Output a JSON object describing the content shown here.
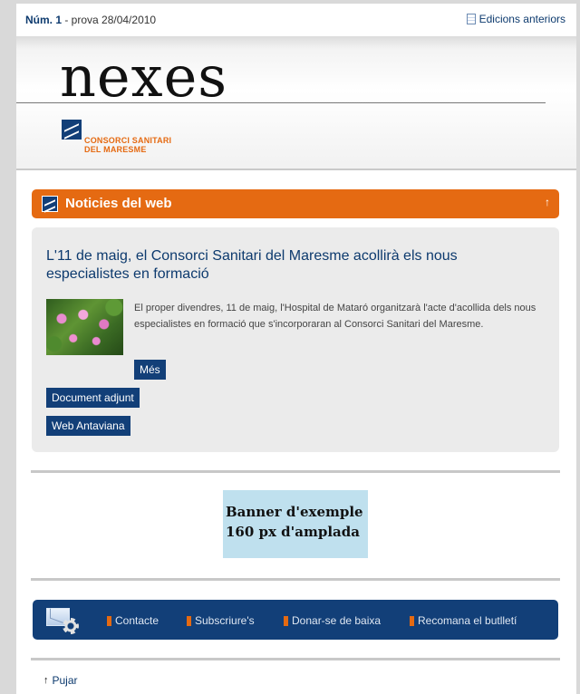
{
  "topbar": {
    "issue_number": "Núm. 1",
    "issue_suffix": " - prova 28/04/2010",
    "previous_editions": "Edicions anteriors"
  },
  "header": {
    "logo": "nexes",
    "brand_line1": "CONSORCI SANITARI",
    "brand_line2": "DEL MARESME"
  },
  "section": {
    "title": "Noticies del web",
    "collapse_glyph": "↑"
  },
  "news": {
    "title": "L'11 de maig, el Consorci Sanitari del Maresme acollirà els nous especialistes en formació",
    "body": "El proper divendres, 11 de maig, l'Hospital de Mataró organitzarà l'acte d'acollida dels nous especialistes en formació que s'incorporaran al Consorci Sanitari del Maresme.",
    "more_label": "Més",
    "attachment_label": "Document adjunt",
    "web_label": "Web Antaviana"
  },
  "banner": {
    "line1": "Banner d'exemple",
    "line2": "160 px d'amplada"
  },
  "footer_nav": {
    "items": [
      "Contacte",
      "Subscriure's",
      "Donar-se de baixa",
      "Recomana el butlletí"
    ]
  },
  "back_to_top": {
    "glyph": "↑",
    "label": "Pujar"
  },
  "colors": {
    "brand_blue": "#123f78",
    "accent_orange": "#e56a12",
    "card_grey": "#ebebeb",
    "banner_blue": "#bfe0ee"
  }
}
